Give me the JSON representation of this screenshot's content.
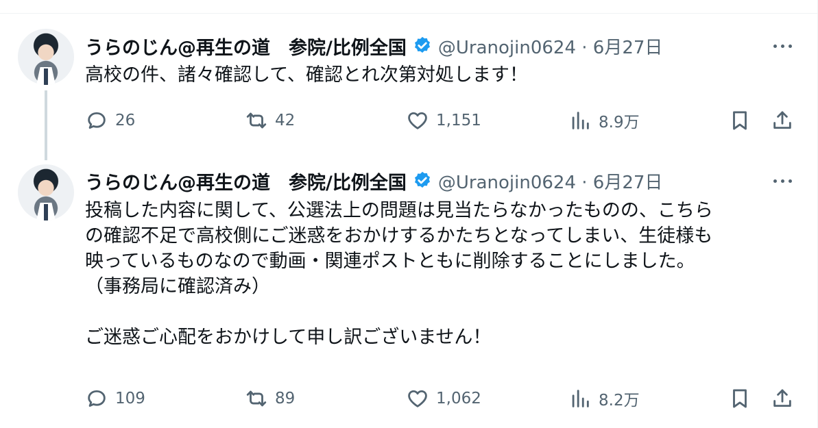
{
  "tweets": [
    {
      "name": "うらのじん@再生の道　参院/比例全国",
      "handle": "@Uranojin0624 · 6月27日",
      "text": "高校の件、諸々確認して、確認とれ次第対処します！",
      "replies": "26",
      "reposts": "42",
      "likes": "1,151",
      "views": "8.9万"
    },
    {
      "name": "うらのじん@再生の道　参院/比例全国",
      "handle": "@Uranojin0624 · 6月27日",
      "text": "投稿した内容に関して、公選法上の問題は見当たらなかったものの、こちら\nの確認不足で高校側にご迷惑をおかけするかたちとなってしまい、生徒様も\n映っているものなので動画・関連ポストともに削除することにしました。\n（事務局に確認済み）\n\nご迷惑ご心配をおかけして申し訳ございません！",
      "replies": "109",
      "reposts": "89",
      "likes": "1,062",
      "views": "8.2万"
    }
  ],
  "colors": {
    "verified": "#1d9bf0",
    "muted": "#536471",
    "text": "#0f1419",
    "thread": "#cfd9de"
  },
  "icons": [
    "verified-badge-icon",
    "more-icon",
    "reply-icon",
    "repost-icon",
    "like-icon",
    "views-icon",
    "bookmark-icon",
    "share-icon"
  ]
}
